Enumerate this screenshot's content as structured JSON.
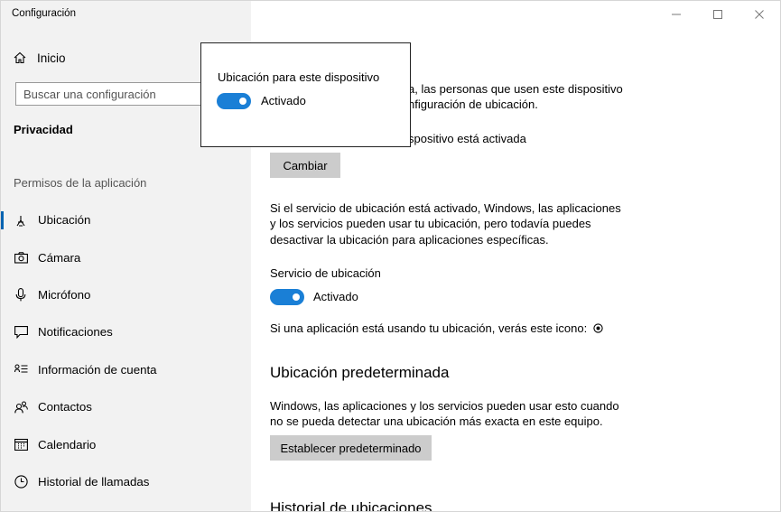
{
  "window": {
    "title": "Configuración",
    "controls": [
      "minimize-icon",
      "maximize-icon",
      "close-icon"
    ]
  },
  "sidebar": {
    "home_label": "Inicio",
    "search_placeholder": "Buscar una configuración",
    "section_title": "Privacidad",
    "group_title": "Permisos de la aplicación",
    "items": [
      {
        "label": "Ubicación",
        "icon": "location-icon",
        "active": true
      },
      {
        "label": "Cámara",
        "icon": "camera-icon"
      },
      {
        "label": "Micrófono",
        "icon": "microphone-icon"
      },
      {
        "label": "Notificaciones",
        "icon": "notifications-icon"
      },
      {
        "label": "Información de cuenta",
        "icon": "account-info-icon"
      },
      {
        "label": "Contactos",
        "icon": "contacts-icon"
      },
      {
        "label": "Calendario",
        "icon": "calendar-icon"
      },
      {
        "label": "Historial de llamadas",
        "icon": "call-history-icon"
      }
    ]
  },
  "main": {
    "intro_line1": "a, las personas que usen este dispositivo",
    "intro_line2": "nfiguración de ubicación.",
    "device_status": "spositivo está activada",
    "change_button": "Cambiar",
    "service_desc": [
      "Si el servicio de ubicación está activado, Windows, las aplicaciones",
      "y los servicios pueden usar tu ubicación, pero todavía puedes",
      "desactivar la ubicación para aplicaciones específicas."
    ],
    "service_label": "Servicio de ubicación",
    "service_state": "Activado",
    "service_on": true,
    "icon_note": "Si una aplicación está usando tu ubicación, verás este icono:",
    "default_heading": "Ubicación predeterminada",
    "default_desc": [
      "Windows, las aplicaciones y los servicios pueden usar esto cuando",
      "no se pueda detectar una ubicación más exacta en este equipo."
    ],
    "default_button": "Establecer predeterminado",
    "history_heading": "Historial de ubicaciones"
  },
  "popup": {
    "title": "Ubicación para este dispositivo",
    "state": "Activado",
    "on": true
  },
  "colors": {
    "accent": "#0063b1",
    "toggle_on": "#1a7fd6",
    "sidebar_bg": "#f2f2f2",
    "button_bg": "#cccccc"
  }
}
